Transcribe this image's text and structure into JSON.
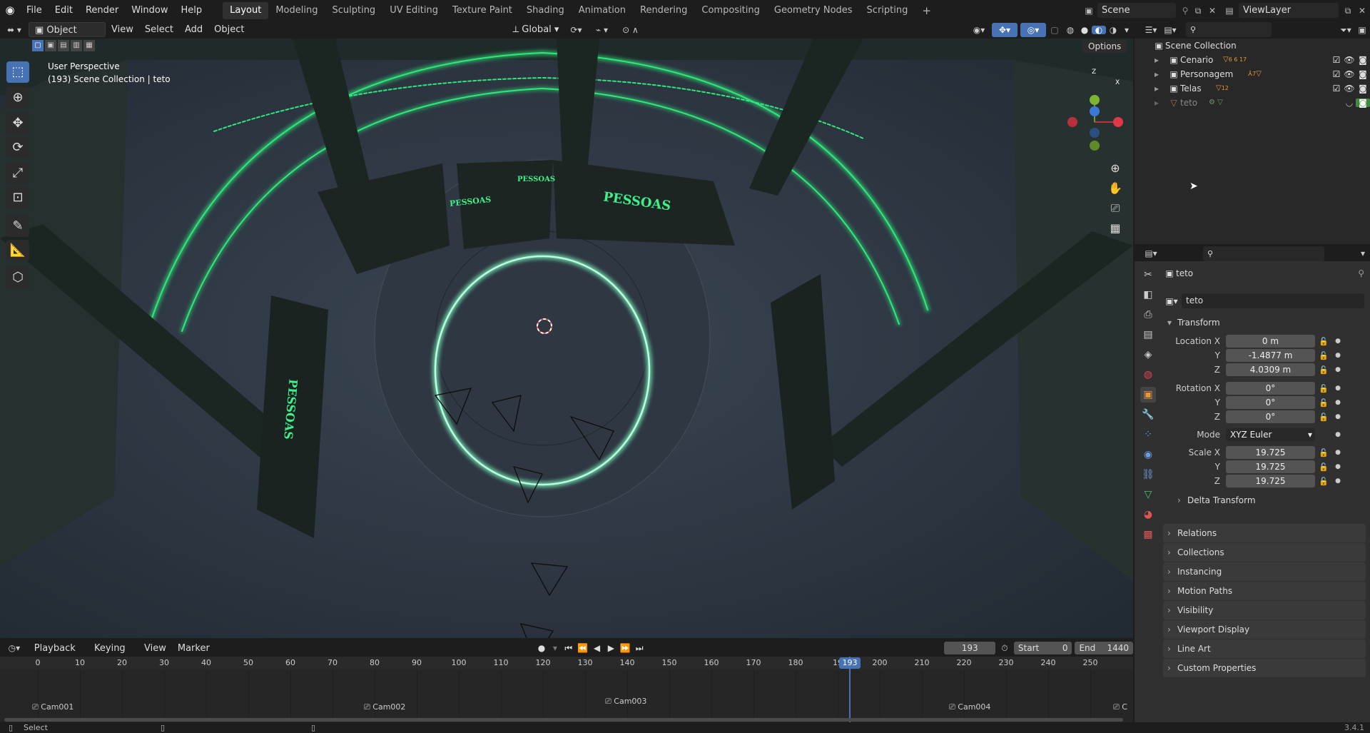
{
  "topbar": {
    "menus": [
      "File",
      "Edit",
      "Render",
      "Window",
      "Help"
    ],
    "workspaces": [
      "Layout",
      "Modeling",
      "Sculpting",
      "UV Editing",
      "Texture Paint",
      "Shading",
      "Animation",
      "Rendering",
      "Compositing",
      "Geometry Nodes",
      "Scripting"
    ],
    "active_workspace": "Layout",
    "add_workspace": "+",
    "scene": "Scene",
    "view_layer": "ViewLayer"
  },
  "viewport_header": {
    "mode": "Object Mode",
    "menus": [
      "View",
      "Select",
      "Add",
      "Object"
    ],
    "orientation": "Global",
    "options": "Options"
  },
  "viewport": {
    "perspective": "User Perspective",
    "collection_info": "(193) Scene Collection | teto",
    "sign_text": "PESSOAS",
    "gizmo": {
      "x": "X",
      "y": "Y",
      "z": "Z"
    }
  },
  "outliner": {
    "root": "Scene Collection",
    "items": [
      {
        "label": "Cenario",
        "badges": "6 6 17"
      },
      {
        "label": "Personagem",
        "badges": "7"
      },
      {
        "label": "Telas",
        "badges": "12"
      },
      {
        "label": "teto",
        "badges": ""
      }
    ]
  },
  "properties": {
    "object_name": "teto",
    "data_name": "teto",
    "transform": {
      "title": "Transform",
      "location_label": "Location X",
      "location": [
        "0 m",
        "-1.4877 m",
        "4.0309 m"
      ],
      "rotation_label": "Rotation X",
      "rotation": [
        "0°",
        "0°",
        "0°"
      ],
      "mode_label": "Mode",
      "mode": "XYZ Euler",
      "scale_label": "Scale X",
      "scale": [
        "19.725",
        "19.725",
        "19.725"
      ],
      "y": "Y",
      "z": "Z"
    },
    "delta": "Delta Transform",
    "panels": [
      "Relations",
      "Collections",
      "Instancing",
      "Motion Paths",
      "Visibility",
      "Viewport Display",
      "Line Art",
      "Custom Properties"
    ]
  },
  "timeline": {
    "menus": [
      "Playback",
      "Keying",
      "View",
      "Marker"
    ],
    "current_frame": "193",
    "start_label": "Start",
    "start": "0",
    "end_label": "End",
    "end": "1440",
    "ticks": [
      "0",
      "10",
      "20",
      "30",
      "40",
      "50",
      "60",
      "70",
      "80",
      "90",
      "100",
      "110",
      "120",
      "130",
      "140",
      "150",
      "160",
      "170",
      "180",
      "19",
      "200",
      "210",
      "220",
      "230",
      "240",
      "250"
    ],
    "markers": [
      "Cam001",
      "Cam002",
      "Cam003",
      "Cam004",
      "C"
    ]
  },
  "statusbar": {
    "left": "Select",
    "version": "3.4.1"
  },
  "colors": {
    "accent": "#4772b3",
    "neon": "#2ee87a",
    "orange": "#e8963a"
  }
}
